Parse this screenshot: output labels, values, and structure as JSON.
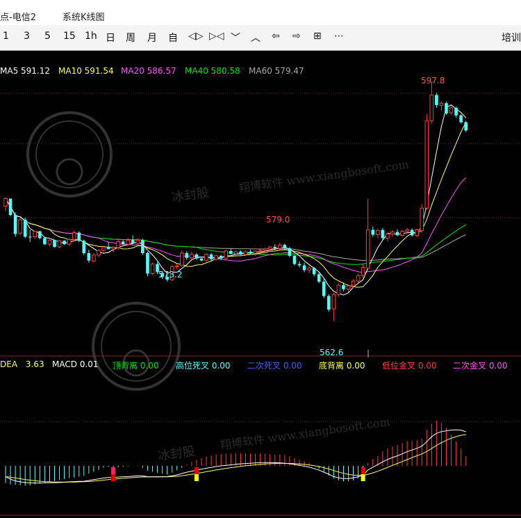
{
  "window": {
    "title_left": "点-电信2",
    "title_menu": "系统K线图"
  },
  "toolbar": {
    "items": [
      "1",
      "3",
      "5",
      "15",
      "1h",
      "日",
      "周",
      "月",
      "自",
      "◁▷",
      "▷◁",
      "﹀",
      "︿",
      "⇦",
      "⇨",
      "⊞",
      "⋯"
    ],
    "right_label": "培训"
  },
  "legend": {
    "ma5_label": "MA5",
    "ma5_value": "591.12",
    "ma10_label": "MA10",
    "ma10_value": "591.54",
    "ma20_label": "MA20",
    "ma20_value": "586.57",
    "ma40_label": "MA40",
    "ma40_value": "580.58",
    "ma60_label": "MA60",
    "ma60_value": "579.47"
  },
  "macd_legend": {
    "dea_label": "DEA",
    "dea_value": "3.63",
    "macd_label": "MACD",
    "macd_value": "0.01",
    "items": [
      {
        "label": "顶背离",
        "value": "0.00"
      },
      {
        "label": "高位死叉",
        "value": "0.00"
      },
      {
        "label": "二次死叉",
        "value": "0.00"
      },
      {
        "label": "底背离",
        "value": "0.00"
      },
      {
        "label": "低位金叉",
        "value": "0.00"
      },
      {
        "label": "二次金叉",
        "value": "0.00"
      }
    ]
  },
  "annotations": {
    "high": "597.8",
    "mid_high": "579.0",
    "mid_low": "573.2",
    "low": "562.6"
  },
  "watermark": {
    "brand": "冰封股",
    "site": "翔博软件 www.xiangbosoft.com"
  },
  "colors": {
    "ma5": "#ffffff",
    "ma10": "#ffff54",
    "ma20": "#ff54ff",
    "ma40": "#00e600",
    "ma60": "#a8a8a8",
    "up": "#ff3c3c",
    "down": "#54fcfc",
    "dea": "#ffff54",
    "dif": "#ffffff"
  },
  "chart_data": {
    "type": "candlestick",
    "y_range": [
      560,
      600
    ],
    "candles": [
      [
        579.5,
        580.8,
        578.8,
        580.6
      ],
      [
        580.6,
        580.6,
        578.0,
        578.2
      ],
      [
        578.2,
        578.6,
        575.0,
        575.4
      ],
      [
        575.5,
        577.8,
        575.2,
        577.5
      ],
      [
        577.5,
        577.8,
        574.8,
        575.0
      ],
      [
        575.0,
        576.0,
        574.2,
        574.9
      ],
      [
        575.0,
        575.9,
        574.7,
        575.8
      ],
      [
        575.8,
        575.9,
        574.6,
        574.8
      ],
      [
        574.8,
        574.9,
        573.8,
        573.9
      ],
      [
        573.9,
        574.8,
        573.6,
        574.5
      ],
      [
        574.5,
        574.6,
        573.4,
        573.5
      ],
      [
        573.5,
        574.5,
        573.3,
        574.4
      ],
      [
        574.4,
        574.5,
        573.8,
        573.9
      ],
      [
        573.9,
        574.8,
        573.6,
        574.6
      ],
      [
        574.6,
        575.9,
        574.3,
        575.6
      ],
      [
        575.6,
        575.8,
        574.2,
        574.4
      ],
      [
        574.4,
        574.6,
        572.3,
        572.6
      ],
      [
        572.6,
        573.1,
        571.2,
        571.5
      ],
      [
        571.4,
        572.6,
        571.2,
        572.3
      ],
      [
        572.3,
        573.2,
        572.0,
        573.0
      ],
      [
        573.0,
        573.7,
        572.7,
        573.5
      ],
      [
        573.5,
        574.2,
        573.1,
        573.2
      ],
      [
        573.2,
        573.6,
        572.7,
        573.4
      ],
      [
        573.4,
        574.5,
        573.1,
        574.3
      ],
      [
        574.3,
        574.6,
        573.8,
        573.9
      ],
      [
        573.9,
        574.8,
        573.6,
        574.5
      ],
      [
        574.5,
        575.2,
        573.9,
        574.0
      ],
      [
        574.0,
        574.8,
        573.7,
        574.5
      ],
      [
        574.5,
        574.7,
        572.3,
        572.6
      ],
      [
        572.6,
        572.8,
        569.2,
        569.6
      ],
      [
        569.6,
        571.2,
        569.4,
        571.0
      ],
      [
        571.0,
        571.3,
        569.5,
        569.8
      ],
      [
        569.7,
        570.0,
        568.8,
        569.1
      ],
      [
        569.1,
        569.6,
        568.4,
        568.7
      ],
      [
        568.7,
        570.8,
        568.5,
        570.6
      ],
      [
        570.6,
        571.0,
        570.2,
        570.7
      ],
      [
        570.8,
        573.0,
        570.6,
        572.6
      ],
      [
        572.6,
        572.9,
        571.6,
        571.9
      ],
      [
        571.9,
        572.8,
        571.6,
        572.4
      ],
      [
        572.4,
        572.6,
        571.6,
        571.8
      ],
      [
        571.8,
        572.1,
        571.4,
        571.5
      ],
      [
        571.5,
        572.6,
        571.3,
        572.4
      ],
      [
        572.4,
        572.6,
        571.4,
        571.7
      ],
      [
        571.7,
        572.4,
        571.5,
        572.2
      ],
      [
        572.2,
        572.3,
        571.6,
        571.8
      ],
      [
        571.8,
        573.1,
        571.6,
        572.9
      ],
      [
        572.9,
        573.2,
        572.4,
        572.5
      ],
      [
        572.5,
        573.0,
        572.0,
        572.8
      ],
      [
        572.8,
        573.0,
        572.3,
        572.4
      ],
      [
        572.4,
        573.0,
        572.2,
        572.8
      ],
      [
        572.8,
        573.1,
        572.4,
        572.6
      ],
      [
        572.6,
        573.0,
        572.2,
        572.9
      ],
      [
        572.9,
        573.2,
        572.6,
        573.0
      ],
      [
        573.0,
        573.4,
        572.7,
        573.2
      ],
      [
        573.2,
        573.6,
        572.8,
        573.5
      ],
      [
        573.5,
        573.9,
        573.0,
        573.3
      ],
      [
        573.3,
        574.1,
        573.0,
        573.8
      ],
      [
        573.8,
        574.0,
        573.1,
        573.3
      ],
      [
        573.3,
        573.5,
        572.0,
        572.2
      ],
      [
        572.2,
        572.4,
        570.8,
        571.0
      ],
      [
        571.0,
        571.4,
        570.5,
        570.8
      ],
      [
        570.8,
        571.2,
        569.8,
        570.1
      ],
      [
        570.1,
        570.7,
        569.6,
        570.4
      ],
      [
        570.4,
        570.6,
        569.2,
        569.5
      ],
      [
        569.5,
        569.8,
        568.2,
        568.4
      ],
      [
        568.4,
        568.8,
        566.0,
        566.3
      ],
      [
        566.3,
        566.6,
        564.0,
        564.3
      ],
      [
        564.4,
        566.8,
        562.6,
        566.5
      ],
      [
        566.5,
        568.2,
        566.2,
        567.9
      ],
      [
        567.9,
        568.3,
        567.0,
        567.3
      ],
      [
        567.3,
        568.0,
        566.9,
        567.8
      ],
      [
        567.8,
        568.8,
        567.5,
        568.5
      ],
      [
        568.5,
        569.6,
        568.2,
        569.3
      ],
      [
        569.3,
        571.0,
        569.0,
        570.5
      ],
      [
        570.4,
        580.6,
        570.0,
        576.0
      ],
      [
        576.0,
        576.5,
        575.0,
        575.3
      ],
      [
        575.3,
        576.2,
        574.8,
        575.9
      ],
      [
        576.0,
        576.3,
        574.5,
        574.8
      ],
      [
        574.8,
        575.7,
        574.3,
        575.4
      ],
      [
        575.4,
        576.0,
        575.0,
        575.7
      ],
      [
        575.7,
        576.1,
        575.1,
        575.2
      ],
      [
        575.2,
        576.0,
        575.0,
        575.8
      ],
      [
        575.8,
        576.3,
        575.4,
        576.0
      ],
      [
        576.0,
        576.2,
        575.0,
        575.2
      ],
      [
        575.2,
        576.2,
        574.9,
        576.0
      ],
      [
        575.9,
        579.8,
        575.6,
        579.2
      ],
      [
        579.2,
        593.0,
        579.0,
        592.0
      ],
      [
        592.0,
        597.8,
        591.5,
        595.8
      ],
      [
        595.8,
        596.1,
        593.9,
        594.3
      ],
      [
        594.3,
        594.9,
        593.5,
        594.6
      ],
      [
        594.6,
        594.8,
        592.9,
        593.1
      ],
      [
        593.2,
        594.2,
        592.9,
        593.9
      ],
      [
        593.9,
        594.1,
        592.5,
        592.8
      ],
      [
        592.8,
        593.0,
        591.6,
        591.8
      ],
      [
        591.8,
        592.0,
        590.4,
        590.6
      ]
    ],
    "macd": [
      -3.5,
      -3.8,
      -3.9,
      -4.0,
      -4.1,
      -4.0,
      -3.8,
      -3.6,
      -3.5,
      -3.3,
      -3.1,
      -2.9,
      -2.7,
      -2.5,
      -2.4,
      -2.2,
      -2.0,
      -1.6,
      -1.2,
      -0.8,
      -0.4,
      -0.2,
      -0.4,
      -0.3,
      -0.2,
      -0.1,
      0.0,
      0.1,
      -0.4,
      -1.0,
      -1.2,
      -1.4,
      -1.6,
      -1.8,
      -1.4,
      -0.9,
      -0.4,
      0.2,
      0.8,
      1.2,
      1.6,
      1.9,
      2.1,
      2.3,
      2.4,
      2.5,
      2.5,
      2.6,
      2.6,
      2.6,
      2.5,
      2.5,
      2.5,
      2.5,
      2.4,
      2.3,
      2.3,
      2.2,
      2.0,
      1.6,
      1.3,
      1.0,
      0.6,
      0.1,
      -0.6,
      -1.2,
      -2.0,
      -2.6,
      -3.0,
      -3.2,
      -3.2,
      -3.0,
      -2.6,
      -1.8,
      0.6,
      1.4,
      2.0,
      3.0,
      3.6,
      4.0,
      4.3,
      4.7,
      5.1,
      5.2,
      5.3,
      5.6,
      7.4,
      8.6,
      9.3,
      8.8,
      7.8,
      6.4,
      5.0,
      3.6,
      2.0
    ],
    "dif": [
      -6.5,
      -8.0,
      -9.0,
      -9.6,
      -10.0,
      -10.2,
      -10.3,
      -10.3,
      -10.2,
      -10.1,
      -10.1,
      -10.0,
      -9.8,
      -9.6,
      -9.4,
      -9.3,
      -9.2,
      -8.8,
      -8.2,
      -7.8,
      -7.3,
      -7.0,
      -6.9,
      -6.7,
      -6.5,
      -6.4,
      -6.2,
      -6.0,
      -6.0,
      -6.5,
      -6.6,
      -6.6,
      -6.5,
      -6.4,
      -6.0,
      -5.4,
      -4.6,
      -3.8,
      -3.2,
      -2.6,
      -2.0,
      -1.4,
      -0.9,
      -0.4,
      0.0,
      0.3,
      0.6,
      0.9,
      1.2,
      1.4,
      1.6,
      1.8,
      1.9,
      2.0,
      2.0,
      1.9,
      1.8,
      1.6,
      1.3,
      0.8,
      0.3,
      -0.2,
      -0.8,
      -1.6,
      -2.6,
      -3.8,
      -5.0,
      -6.4,
      -7.2,
      -7.6,
      -7.6,
      -7.2,
      -6.6,
      -5.5,
      -2.5,
      -0.8,
      0.8,
      2.4,
      3.8,
      5.0,
      6.0,
      7.2,
      8.5,
      9.5,
      10.5,
      11.8,
      14.5,
      17.5,
      19.5,
      20.5,
      21.0,
      21.4,
      21.6,
      21.4,
      20.4
    ]
  }
}
